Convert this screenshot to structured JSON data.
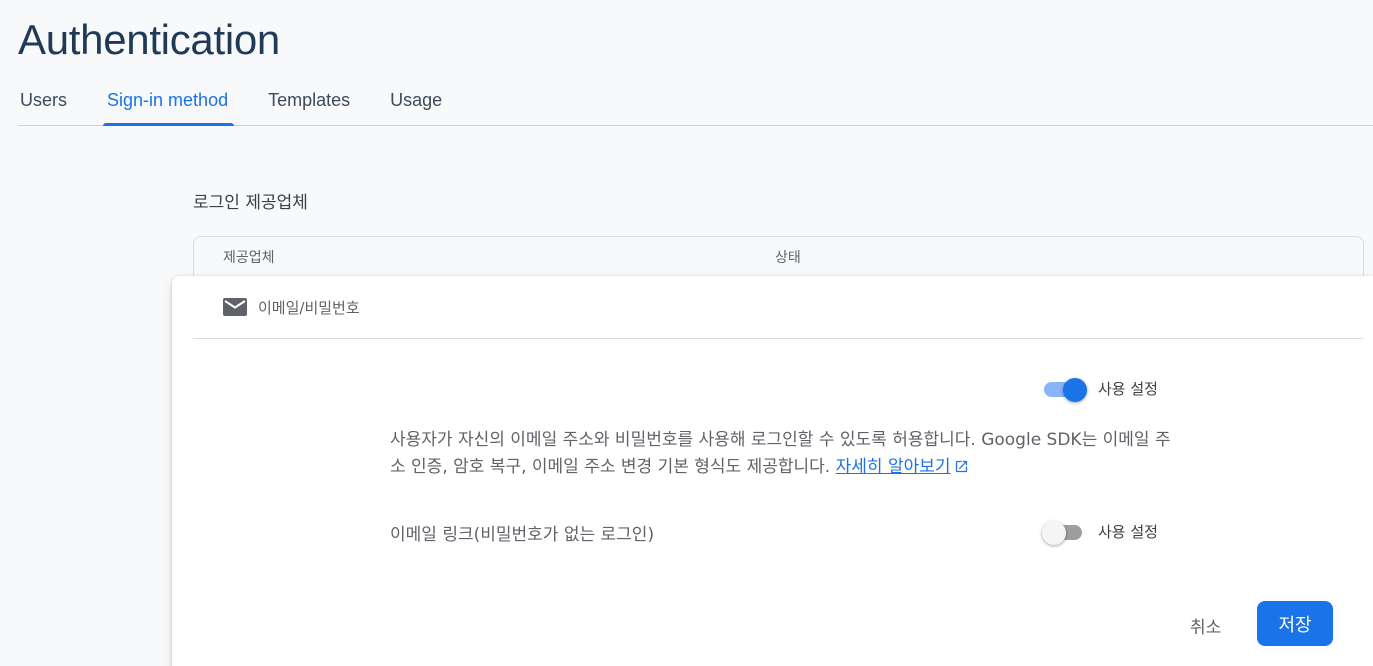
{
  "header": {
    "title": "Authentication"
  },
  "tabs": [
    {
      "label": "Users",
      "active": false
    },
    {
      "label": "Sign-in method",
      "active": true
    },
    {
      "label": "Templates",
      "active": false
    },
    {
      "label": "Usage",
      "active": false
    }
  ],
  "section": {
    "title": "로그인 제공업체"
  },
  "table": {
    "columns": [
      "제공업체",
      "상태"
    ]
  },
  "provider_panel": {
    "provider_icon": "mail-icon",
    "provider_name": "이메일/비밀번호",
    "enable_toggle": {
      "label": "사용 설정",
      "on": true
    },
    "description": "사용자가 자신의 이메일 주소와 비밀번호를 사용해 로그인할 수 있도록 허용합니다. Google SDK는 이메일 주소 인증, 암호 복구, 이메일 주소 변경 기본 형식도 제공합니다.",
    "learn_more_label": "자세히 알아보기",
    "learn_more_icon": "external-link-icon",
    "email_link": {
      "label": "이메일 링크(비밀번호가 없는 로그인)",
      "toggle_label": "사용 설정",
      "on": false
    },
    "cancel_label": "취소",
    "save_label": "저장"
  },
  "colors": {
    "accent": "#1a73e8",
    "title": "#1f3a57",
    "background": "#f8f9fa"
  }
}
